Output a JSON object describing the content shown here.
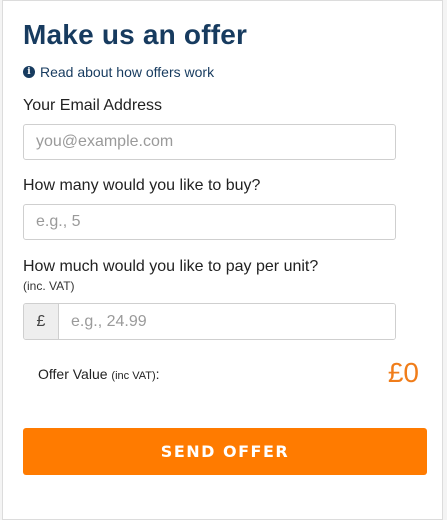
{
  "form": {
    "title": "Make us an offer",
    "info_icon_glyph": "i",
    "info_link": "Read about how offers work",
    "email": {
      "label": "Your Email Address",
      "placeholder": "you@example.com"
    },
    "quantity": {
      "label": "How many would you like to buy?",
      "placeholder": "e.g., 5"
    },
    "price": {
      "label": "How much would you like to pay per unit?",
      "sublabel": "(inc. VAT)",
      "currency": "£",
      "placeholder": "e.g., 24.99"
    },
    "offer": {
      "label": "Offer Value",
      "label_note": "(inc VAT)",
      "colon": ":",
      "value": "£0"
    },
    "submit_label": "SEND OFFER"
  },
  "colors": {
    "title": "#173b5f",
    "accent": "#ff7b00",
    "offer_value": "#f07d1a"
  },
  "icons": {
    "info": "info-circle-icon"
  }
}
